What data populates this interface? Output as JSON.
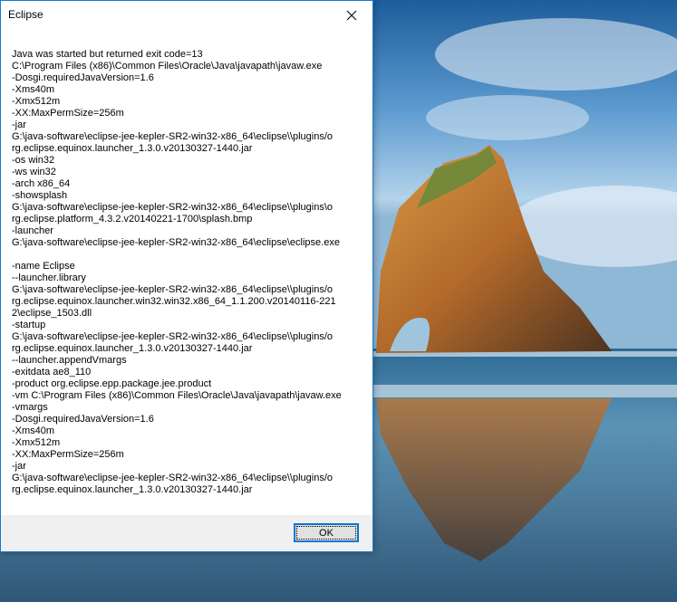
{
  "dialog": {
    "title": "Eclipse",
    "close_icon": "close-icon",
    "message_lines": [
      "Java was started but returned exit code=13",
      "C:\\Program Files (x86)\\Common Files\\Oracle\\Java\\javapath\\javaw.exe",
      "-Dosgi.requiredJavaVersion=1.6",
      "-Xms40m",
      "-Xmx512m",
      "-XX:MaxPermSize=256m",
      "-jar",
      "G:\\java-software\\eclipse-jee-kepler-SR2-win32-x86_64\\eclipse\\\\plugins/o",
      "rg.eclipse.equinox.launcher_1.3.0.v20130327-1440.jar",
      "-os win32",
      "-ws win32",
      "-arch x86_64",
      "-showsplash",
      "G:\\java-software\\eclipse-jee-kepler-SR2-win32-x86_64\\eclipse\\\\plugins\\o",
      "rg.eclipse.platform_4.3.2.v20140221-1700\\splash.bmp",
      "-launcher",
      "G:\\java-software\\eclipse-jee-kepler-SR2-win32-x86_64\\eclipse\\eclipse.exe",
      "",
      "-name Eclipse",
      "--launcher.library",
      "G:\\java-software\\eclipse-jee-kepler-SR2-win32-x86_64\\eclipse\\\\plugins/o",
      "rg.eclipse.equinox.launcher.win32.win32.x86_64_1.1.200.v20140116-221",
      "2\\eclipse_1503.dll",
      "-startup",
      "G:\\java-software\\eclipse-jee-kepler-SR2-win32-x86_64\\eclipse\\\\plugins/o",
      "rg.eclipse.equinox.launcher_1.3.0.v20130327-1440.jar",
      "--launcher.appendVmargs",
      "-exitdata ae8_110",
      "-product org.eclipse.epp.package.jee.product",
      "-vm C:\\Program Files (x86)\\Common Files\\Oracle\\Java\\javapath\\javaw.exe",
      "-vmargs",
      "-Dosgi.requiredJavaVersion=1.6",
      "-Xms40m",
      "-Xmx512m",
      "-XX:MaxPermSize=256m",
      "-jar",
      "G:\\java-software\\eclipse-jee-kepler-SR2-win32-x86_64\\eclipse\\\\plugins/o",
      "rg.eclipse.equinox.launcher_1.3.0.v20130327-1440.jar"
    ],
    "ok_label": "OK"
  },
  "colors": {
    "accent": "#0078d7",
    "window_border": "#1979ca",
    "button_bar": "#f0f0f0"
  }
}
